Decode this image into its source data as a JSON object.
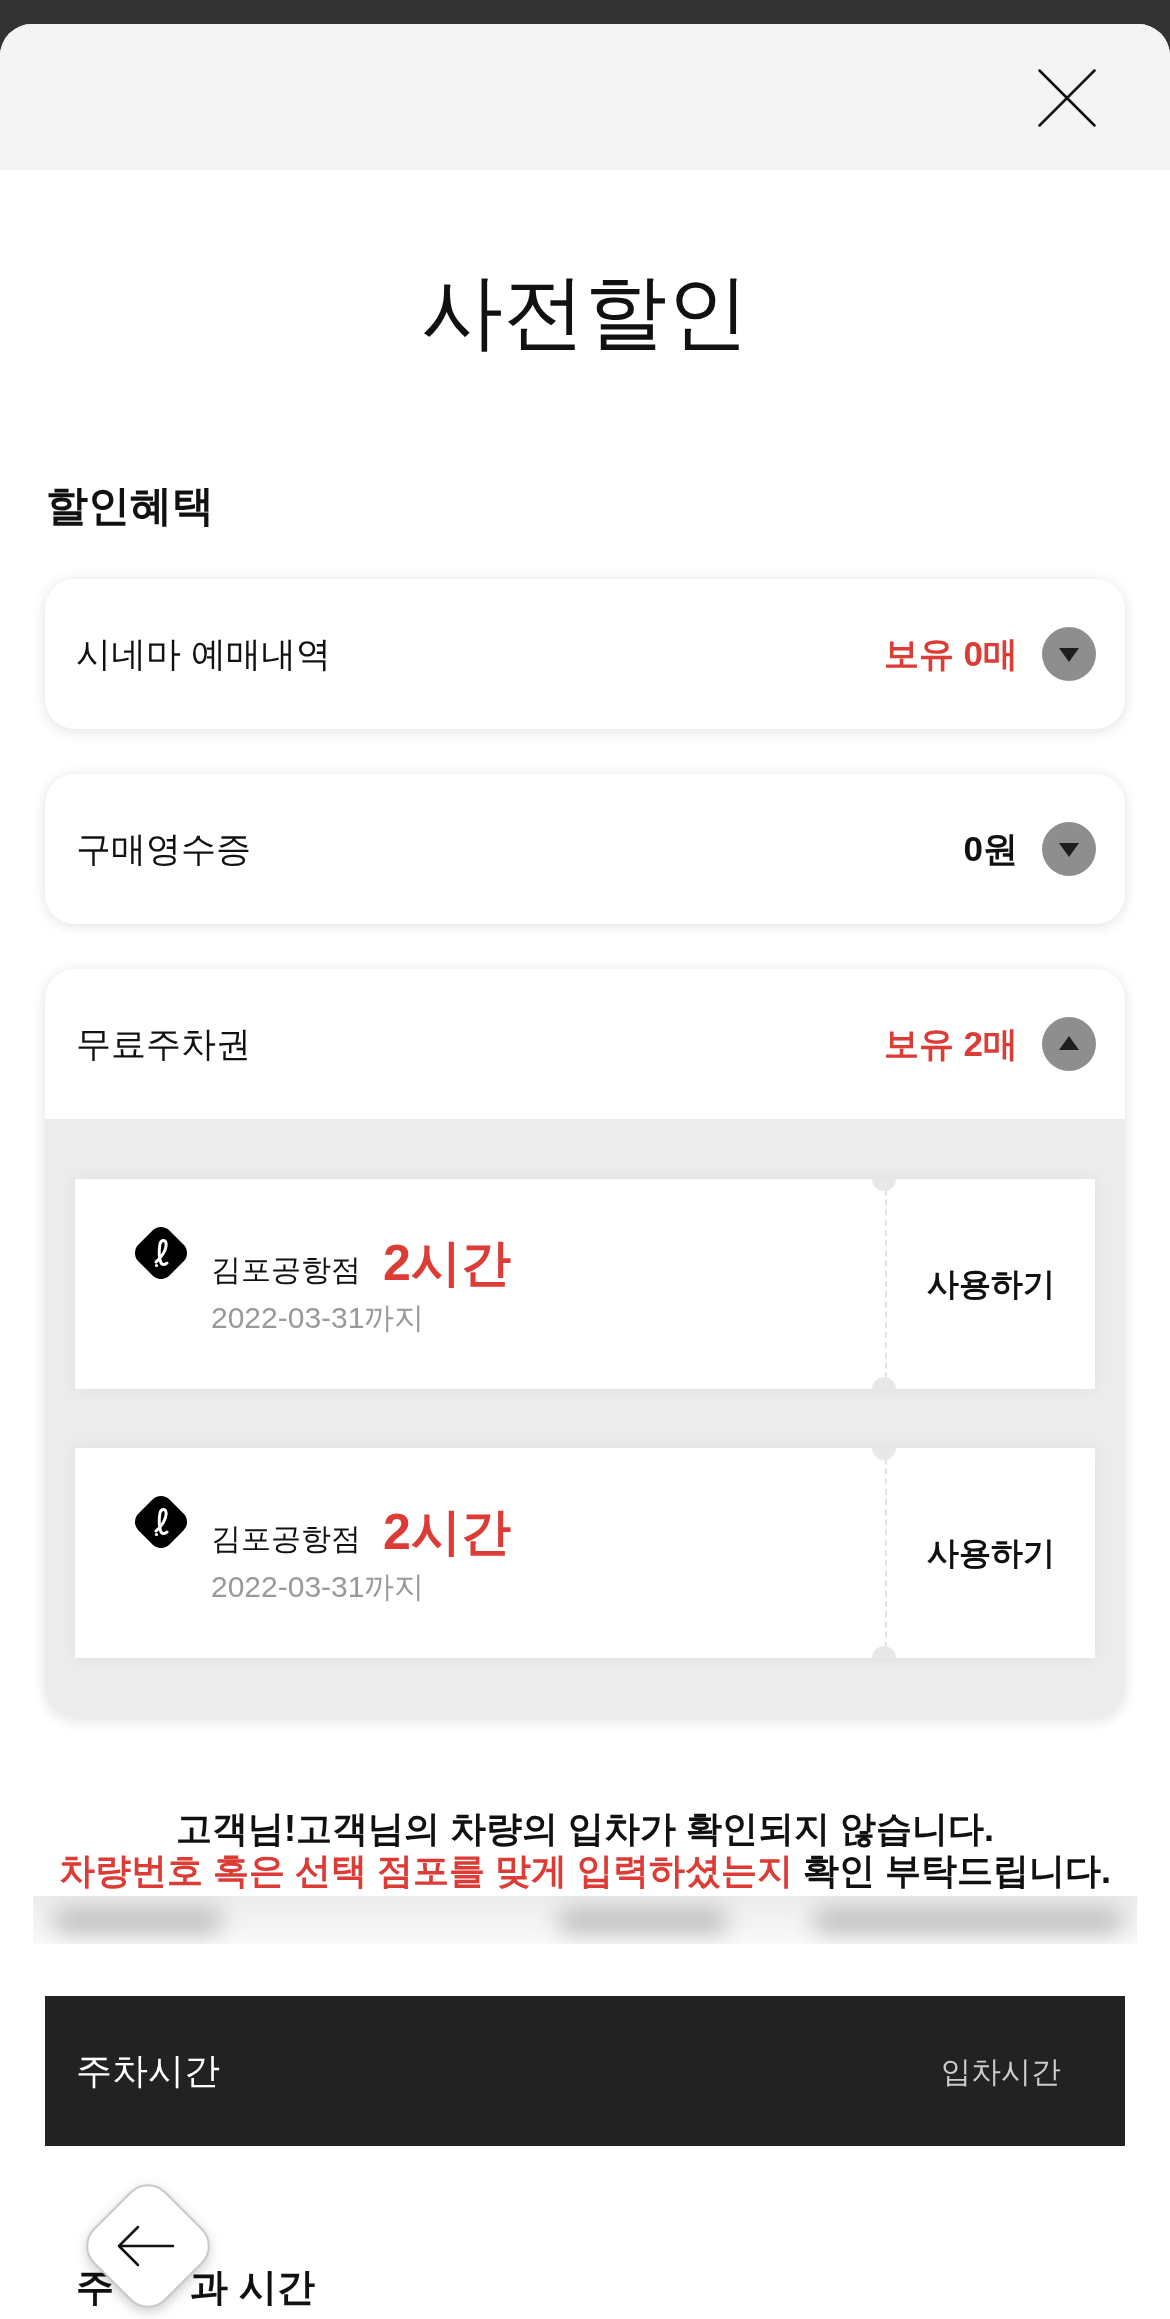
{
  "sheet": {
    "title": "사전할인"
  },
  "section_title": "할인혜택",
  "accordions": [
    {
      "label": "시네마 예매내역",
      "value": "보유 0매",
      "highlighted": true,
      "expanded": false
    },
    {
      "label": "구매영수증",
      "value": "0원",
      "highlighted": false,
      "expanded": false
    },
    {
      "label": "무료주차권",
      "value": "보유 2매",
      "highlighted": true,
      "expanded": true,
      "coupons": [
        {
          "store": "김포공항점",
          "duration": "2시간",
          "expiry": "2022-03-31까지",
          "action": "사용하기"
        },
        {
          "store": "김포공항점",
          "duration": "2시간",
          "expiry": "2022-03-31까지",
          "action": "사용하기"
        }
      ]
    }
  ],
  "notice": {
    "line_1": "고객님!고객님의 차량의 입차가 확인되지 않습니다.",
    "highlight": "차량번호 혹은 선택 점포를 맞게 입력하셨는지",
    "rest": "확인 부탁드립니다."
  },
  "parking_bar": {
    "label": "주차시간",
    "value": "입차시간"
  },
  "next_section": {
    "heading_start": "주",
    "heading_end": "과 시간"
  }
}
